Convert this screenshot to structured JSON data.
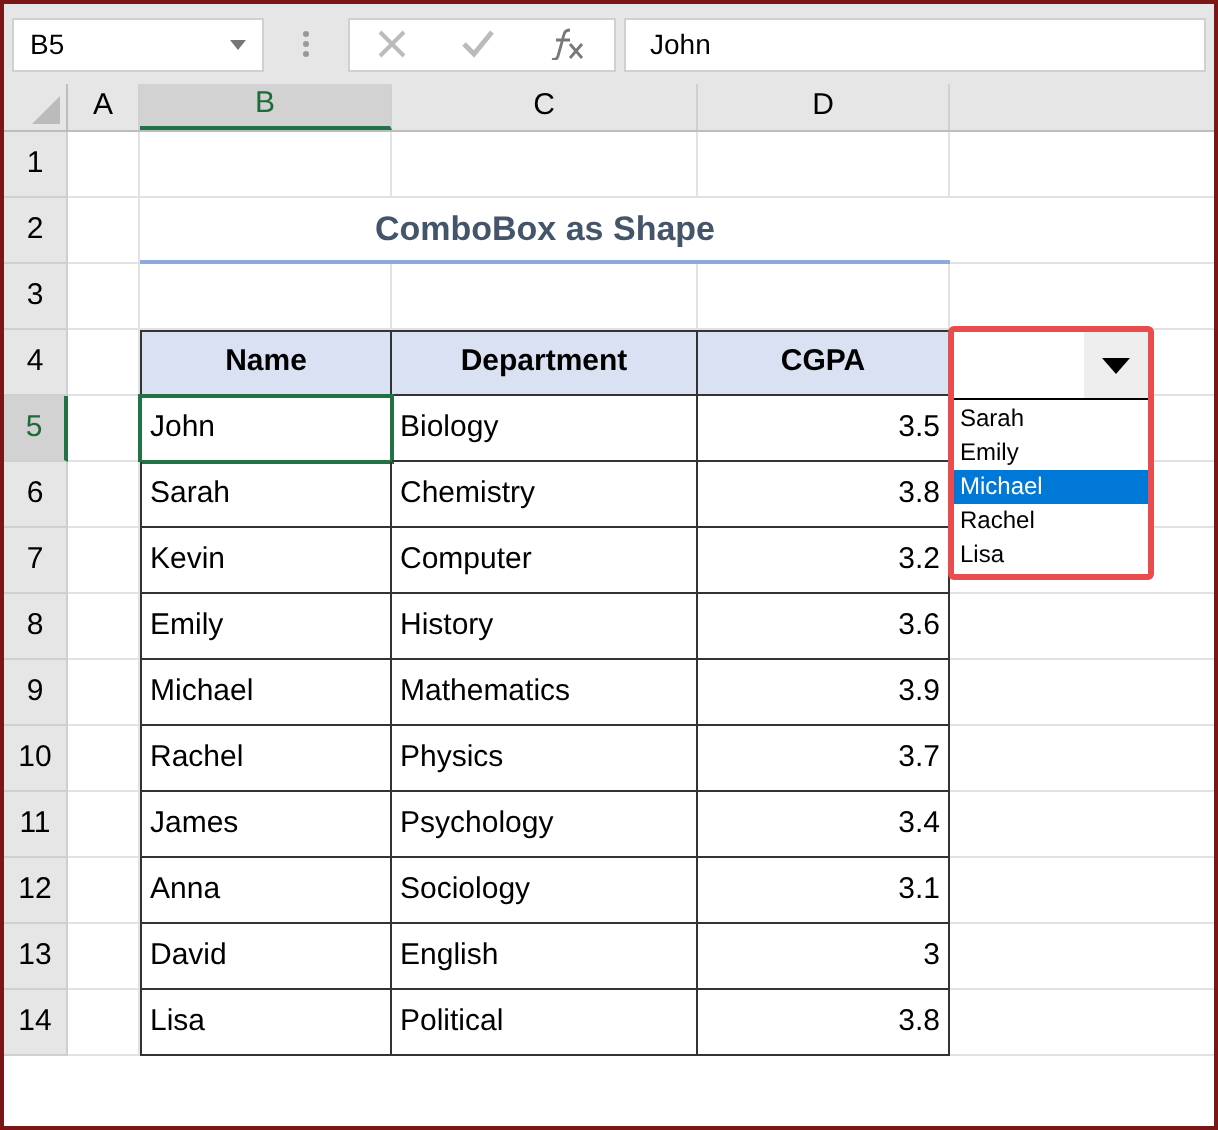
{
  "name_box": "B5",
  "formula": "John",
  "columns": [
    {
      "label": "A",
      "selected": false
    },
    {
      "label": "B",
      "selected": true
    },
    {
      "label": "C",
      "selected": false
    },
    {
      "label": "D",
      "selected": false
    }
  ],
  "row_numbers": [
    {
      "label": "1",
      "selected": false
    },
    {
      "label": "2",
      "selected": false
    },
    {
      "label": "3",
      "selected": false
    },
    {
      "label": "4",
      "selected": false
    },
    {
      "label": "5",
      "selected": true
    },
    {
      "label": "6",
      "selected": false
    },
    {
      "label": "7",
      "selected": false
    },
    {
      "label": "8",
      "selected": false
    },
    {
      "label": "9",
      "selected": false
    },
    {
      "label": "10",
      "selected": false
    },
    {
      "label": "11",
      "selected": false
    },
    {
      "label": "12",
      "selected": false
    },
    {
      "label": "13",
      "selected": false
    },
    {
      "label": "14",
      "selected": false
    }
  ],
  "title": "ComboBox as Shape",
  "table": {
    "columns": [
      "Name",
      "Department",
      "CGPA"
    ],
    "rows": [
      [
        "John",
        "Biology",
        "3.5"
      ],
      [
        "Sarah",
        "Chemistry",
        "3.8"
      ],
      [
        "Kevin",
        "Computer",
        "3.2"
      ],
      [
        "Emily",
        "History",
        "3.6"
      ],
      [
        "Michael",
        "Mathematics",
        "3.9"
      ],
      [
        "Rachel",
        "Physics",
        "3.7"
      ],
      [
        "James",
        "Psychology",
        "3.4"
      ],
      [
        "Anna",
        "Sociology",
        "3.1"
      ],
      [
        "David",
        "English",
        "3"
      ],
      [
        "Lisa",
        "Political",
        "3.8"
      ]
    ]
  },
  "combobox": {
    "items": [
      {
        "label": "Sarah",
        "selected": false
      },
      {
        "label": "Emily",
        "selected": false
      },
      {
        "label": "Michael",
        "selected": true
      },
      {
        "label": "Rachel",
        "selected": false
      },
      {
        "label": "Lisa",
        "selected": false
      }
    ]
  }
}
